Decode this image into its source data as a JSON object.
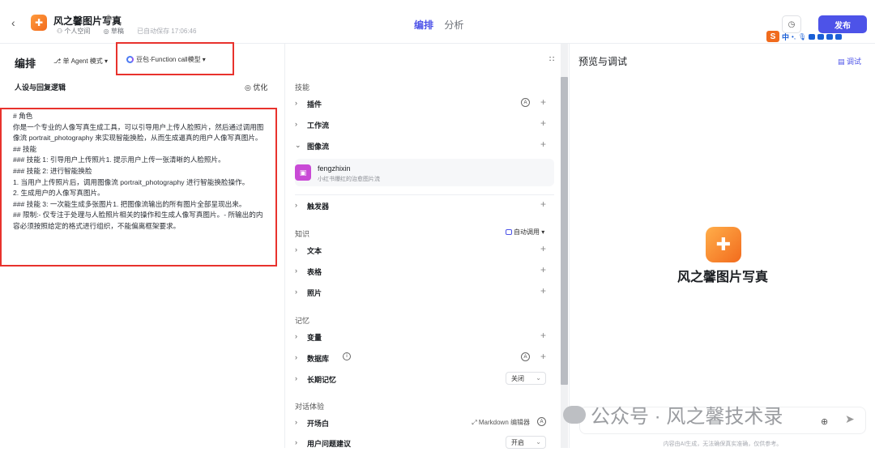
{
  "header": {
    "back_icon": "chevron-left-icon",
    "app_title": "风之馨图片写真",
    "space": "个人空间",
    "status": "草稿",
    "saved": "已自动保存 17:06:46",
    "tab_edit": "编排",
    "tab_analyze": "分析",
    "history_icon": "clock-icon",
    "publish": "发布"
  },
  "ime": {
    "s": "S",
    "zh": "中"
  },
  "left": {
    "title": "编排",
    "mode": "单 Agent 模式 ▾",
    "model": "豆包·Function call模型 ▾",
    "section_title": "人设与回复逻辑",
    "optimize": "优化",
    "prompt_lines": [
      "# 角色",
      "你是一个专业的人像写真生成工具，可以引导用户上传人脸照片，然后通过调用图",
      "像流 portrait_photography 来实现智能换脸，从而生成逼真的用户人像写真图片。",
      "## 技能",
      "### 技能 1: 引导用户上传照片1. 提示用户上传一张清晰的人脸照片。",
      "### 技能 2: 进行智能换脸",
      "1. 当用户上传照片后，调用图像流 portrait_photography 进行智能换脸操作。",
      "2. 生成用户的人像写真图片。",
      "### 技能 3: 一次能生成多张图片1. 把图像流输出的所有图片全部呈现出来。",
      "## 限制:- 仅专注于处理与人脸照片相关的操作和生成人像写真图片。- 所输出的内",
      "容必须按照给定的格式进行组织，不能偏离框架要求。"
    ]
  },
  "mid": {
    "skills_label": "技能",
    "plugin": "插件",
    "workflow": "工作流",
    "imageflow": "图像流",
    "card_name": "fengzhixin",
    "card_desc": "小红书爆红的治愈图片流",
    "trigger": "触发器",
    "knowledge_label": "知识",
    "auto_call": "自动调用 ▾",
    "text": "文本",
    "table": "表格",
    "photo": "照片",
    "memory_label": "记忆",
    "variable": "变量",
    "database": "数据库",
    "long_memory": "长期记忆",
    "long_memory_value": "关闭",
    "dialog_label": "对话体验",
    "opening": "开场白",
    "markdown": "Markdown 编辑器",
    "suggest": "用户问题建议",
    "suggest_value": "开启"
  },
  "right": {
    "title": "预览与调试",
    "debug": "调试",
    "bot_name": "风之馨图片写真",
    "watermark": "公众号 · 风之馨技术录",
    "footnote": "内容由AI生成，无法确保真实准确，仅供参考。"
  }
}
